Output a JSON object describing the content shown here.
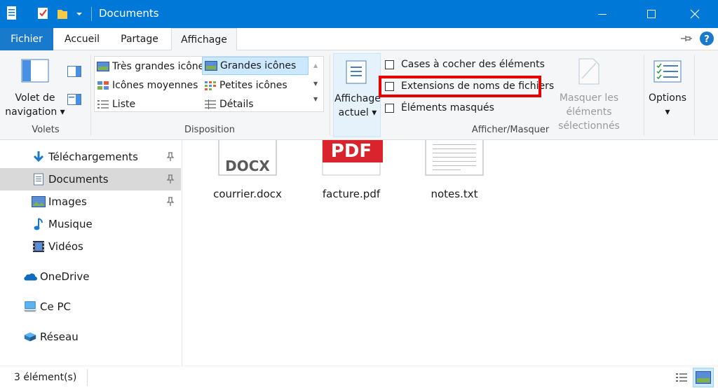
{
  "window": {
    "title": "Documents"
  },
  "tabs": {
    "file": "Fichier",
    "home": "Accueil",
    "share": "Partage",
    "view": "Affichage"
  },
  "ribbon": {
    "panes": {
      "nav_pane_line1": "Volet de",
      "nav_pane_line2": "navigation",
      "group_label": "Volets"
    },
    "layout": {
      "items": [
        "Très grandes icônes",
        "Grandes icônes",
        "Icônes moyennes",
        "Petites icônes",
        "Liste",
        "Détails"
      ],
      "selected": "Grandes icônes",
      "group_label": "Disposition"
    },
    "current_view": {
      "line1": "Affichage",
      "line2": "actuel"
    },
    "show_hide": {
      "item_checkboxes": "Cases à cocher des éléments",
      "file_extensions": "Extensions de noms de fichiers",
      "hidden_items": "Éléments masqués",
      "hide_selected_line1": "Masquer les éléments",
      "hide_selected_line2": "sélectionnés",
      "group_label": "Afficher/Masquer"
    },
    "options": {
      "label": "Options"
    }
  },
  "nav": {
    "downloads": "Téléchargements",
    "documents": "Documents",
    "pictures": "Images",
    "music": "Musique",
    "videos": "Vidéos",
    "onedrive": "OneDrive",
    "this_pc": "Ce PC",
    "network": "Réseau"
  },
  "files": [
    {
      "name": "courrier.docx",
      "badge": "DOCX"
    },
    {
      "name": "facture.pdf",
      "badge": "PDF"
    },
    {
      "name": "notes.txt",
      "badge": ""
    }
  ],
  "status": {
    "count": "3 élément(s)"
  },
  "colors": {
    "accent": "#0078d7",
    "highlight": "#e60000",
    "pdf": "#d9232d"
  }
}
